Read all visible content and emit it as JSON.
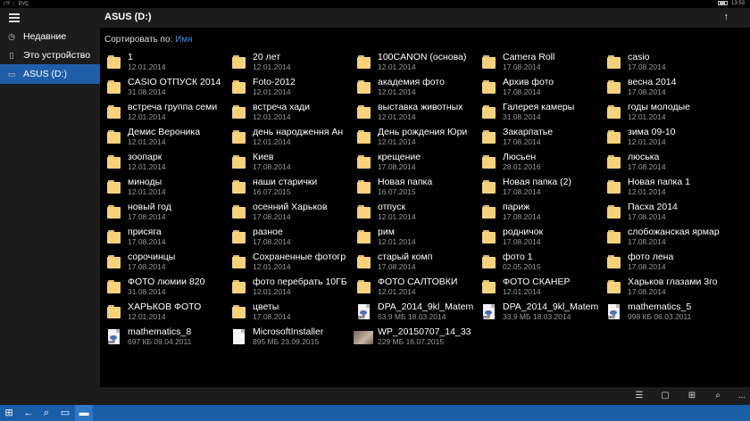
{
  "status_bar": {
    "left": "ᴸᵀᴱ ⋮ РУС",
    "time": "13:53"
  },
  "header": {
    "title": "ASUS  (D:)"
  },
  "sort": {
    "label": "Сортировать по:",
    "value": "Имя"
  },
  "nav": [
    {
      "label": "Недавние",
      "icon": "clock-icon"
    },
    {
      "label": "Это устройство",
      "icon": "phone-icon"
    },
    {
      "label": "ASUS  (D:)",
      "icon": "sd-card-icon"
    }
  ],
  "items": [
    {
      "name": "1",
      "meta": "12.01.2014",
      "type": "folder"
    },
    {
      "name": "20 лет",
      "meta": "12.01.2014",
      "type": "folder"
    },
    {
      "name": "100CANON (основа)",
      "meta": "12.01.2014",
      "type": "folder"
    },
    {
      "name": "Camera Roll",
      "meta": "17.08.2014",
      "type": "folder"
    },
    {
      "name": "casio",
      "meta": "17.08.2014",
      "type": "folder"
    },
    {
      "name": "CASIO ОТПУСК 2014",
      "meta": "31.08.2014",
      "type": "folder"
    },
    {
      "name": "Foto-2012",
      "meta": "12.01.2014",
      "type": "folder"
    },
    {
      "name": "академия фото",
      "meta": "12.01.2014",
      "type": "folder"
    },
    {
      "name": "Архив фото",
      "meta": "17.08.2014",
      "type": "folder"
    },
    {
      "name": "весна 2014",
      "meta": "17.08.2014",
      "type": "folder"
    },
    {
      "name": "встреча группа семи",
      "meta": "12.01.2014",
      "type": "folder"
    },
    {
      "name": "встреча хади",
      "meta": "12.01.2014",
      "type": "folder"
    },
    {
      "name": "выставка животных",
      "meta": "12.01.2014",
      "type": "folder"
    },
    {
      "name": "Галерея камеры",
      "meta": "31.08.2014",
      "type": "folder"
    },
    {
      "name": "годы молодые",
      "meta": "12.01.2014",
      "type": "folder"
    },
    {
      "name": "Демис Вероника",
      "meta": "12.01.2014",
      "type": "folder"
    },
    {
      "name": "день народження Ан",
      "meta": "12.01.2014",
      "type": "folder"
    },
    {
      "name": "День рождения Юри",
      "meta": "12.01.2014",
      "type": "folder"
    },
    {
      "name": "Закарпатье",
      "meta": "17.08.2014",
      "type": "folder"
    },
    {
      "name": "зима 09-10",
      "meta": "12.01.2014",
      "type": "folder"
    },
    {
      "name": "зоопарк",
      "meta": "12.01.2014",
      "type": "folder"
    },
    {
      "name": "Киев",
      "meta": "17.08.2014",
      "type": "folder"
    },
    {
      "name": "крещение",
      "meta": "17.08.2014",
      "type": "folder"
    },
    {
      "name": "Люсьен",
      "meta": "28.01.2016",
      "type": "folder"
    },
    {
      "name": "люська",
      "meta": "17.08.2014",
      "type": "folder"
    },
    {
      "name": "миноды",
      "meta": "12.01.2014",
      "type": "folder"
    },
    {
      "name": "наши старички",
      "meta": "16.07.2015",
      "type": "folder"
    },
    {
      "name": "Новая папка",
      "meta": "16.07.2015",
      "type": "folder"
    },
    {
      "name": "Новая папка (2)",
      "meta": "17.08.2014",
      "type": "folder"
    },
    {
      "name": "Новая папка 1",
      "meta": "12.01.2014",
      "type": "folder"
    },
    {
      "name": "новый год",
      "meta": "17.08.2014",
      "type": "folder"
    },
    {
      "name": "осенний Харьков",
      "meta": "17.08.2014",
      "type": "folder"
    },
    {
      "name": "отпуск",
      "meta": "12.01.2014",
      "type": "folder"
    },
    {
      "name": "париж",
      "meta": "17.08.2014",
      "type": "folder"
    },
    {
      "name": "Пасха 2014",
      "meta": "17.08.2014",
      "type": "folder"
    },
    {
      "name": "присяга",
      "meta": "17.08.2014",
      "type": "folder"
    },
    {
      "name": "разное",
      "meta": "17.08.2014",
      "type": "folder"
    },
    {
      "name": "рим",
      "meta": "12.01.2014",
      "type": "folder"
    },
    {
      "name": "родничок",
      "meta": "17.08.2014",
      "type": "folder"
    },
    {
      "name": "слобожанская ярмар",
      "meta": "17.08.2014",
      "type": "folder"
    },
    {
      "name": "сорочинцы",
      "meta": "17.08.2014",
      "type": "folder"
    },
    {
      "name": "Сохраненные фотогр",
      "meta": "12.01.2014",
      "type": "folder"
    },
    {
      "name": "старый комп",
      "meta": "17.08.2014",
      "type": "folder"
    },
    {
      "name": "фото 1",
      "meta": "02.05.2015",
      "type": "folder"
    },
    {
      "name": "фото лена",
      "meta": "17.08.2014",
      "type": "folder"
    },
    {
      "name": "ФОТО люмии 820",
      "meta": "31.08.2014",
      "type": "folder"
    },
    {
      "name": "фото перебрать 10ГБ",
      "meta": "12.01.2014",
      "type": "folder"
    },
    {
      "name": "ФОТО САЛТОВКИ",
      "meta": "12.01.2014",
      "type": "folder"
    },
    {
      "name": "ФОТО СКАНЕР",
      "meta": "12.01.2014",
      "type": "folder"
    },
    {
      "name": "Харьков глазами 3го",
      "meta": "17.08.2014",
      "type": "folder"
    },
    {
      "name": "ХАРЬКОВ ФОТО",
      "meta": "12.01.2014",
      "type": "folder"
    },
    {
      "name": "цветы",
      "meta": "17.08.2014",
      "type": "folder"
    },
    {
      "name": "DPA_2014_9kl_Matem",
      "meta": "53,9 МБ 18.03.2014",
      "type": "pdf"
    },
    {
      "name": "DPA_2014_9kl_Matem",
      "meta": "33,9 МБ 18.03.2014",
      "type": "pdf"
    },
    {
      "name": "mathematics_5",
      "meta": "998 КБ 06.03.2011",
      "type": "pdf"
    },
    {
      "name": "mathematics_8",
      "meta": "697 КБ 09.04.2011",
      "type": "pdf"
    },
    {
      "name": "MicrosoftInstaller",
      "meta": "895 МБ 23.09.2015",
      "type": "doc"
    },
    {
      "name": "WP_20150707_14_33",
      "meta": "229 МБ 16.07.2015",
      "type": "image"
    }
  ],
  "commands": [
    {
      "icon": "select-list-icon"
    },
    {
      "icon": "new-folder-icon"
    },
    {
      "icon": "view-mode-icon"
    },
    {
      "icon": "search-icon"
    },
    {
      "icon": "more-icon",
      "label": "..."
    }
  ],
  "taskbar": [
    {
      "icon": "start-windows-icon"
    },
    {
      "icon": "back-arrow-icon"
    },
    {
      "icon": "search-icon"
    },
    {
      "icon": "task-view-icon"
    },
    {
      "icon": "file-explorer-icon"
    }
  ]
}
